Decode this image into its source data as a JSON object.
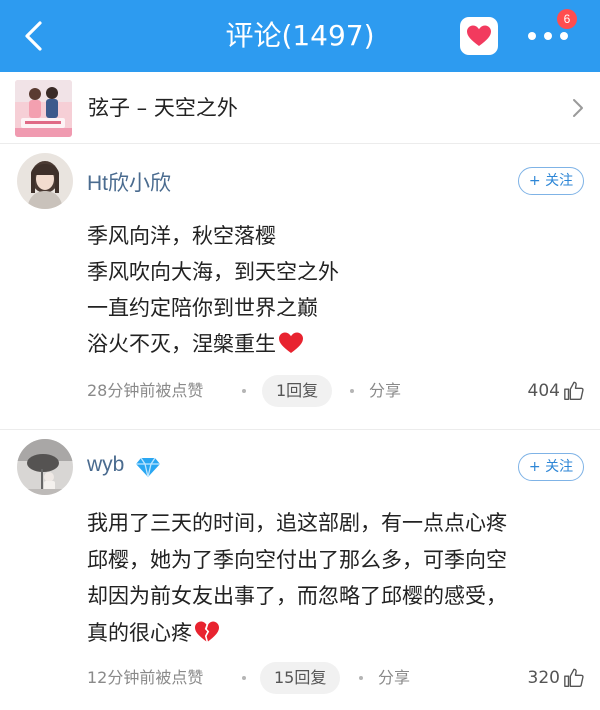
{
  "header": {
    "title": "评论(1497)",
    "badge_count": "6",
    "accent_color": "#2d9bf0",
    "icons": [
      "back-arrow",
      "heart-share",
      "more-dots"
    ]
  },
  "song": {
    "title": "弦子 – 天空之外",
    "cover_icon": "album-cover"
  },
  "comments": [
    {
      "username": "Ht欣小欣",
      "follow_label": "+ 关注",
      "lines": [
        "季风向洋，秋空落樱",
        "季风吹向大海，到天空之外",
        "一直约定陪你到世界之巅",
        "浴火不灭，涅槃重生"
      ],
      "emoji": "red-heart",
      "time": "28分钟前被点赞",
      "reply": "1回复",
      "share": "分享",
      "likes": "404"
    },
    {
      "username": "wyb",
      "vip_icon": "diamond-badge",
      "follow_label": "+ 关注",
      "lines": [
        "我用了三天的时间，追这部剧，有一点点心疼",
        "邱樱，她为了季向空付出了那么多，可季向空",
        "却因为前女友出事了，而忽略了邱樱的感受，",
        "真的很心疼"
      ],
      "emoji": "broken-heart",
      "time": "12分钟前被点赞",
      "reply": "15回复",
      "share": "分享",
      "likes": "320"
    }
  ]
}
